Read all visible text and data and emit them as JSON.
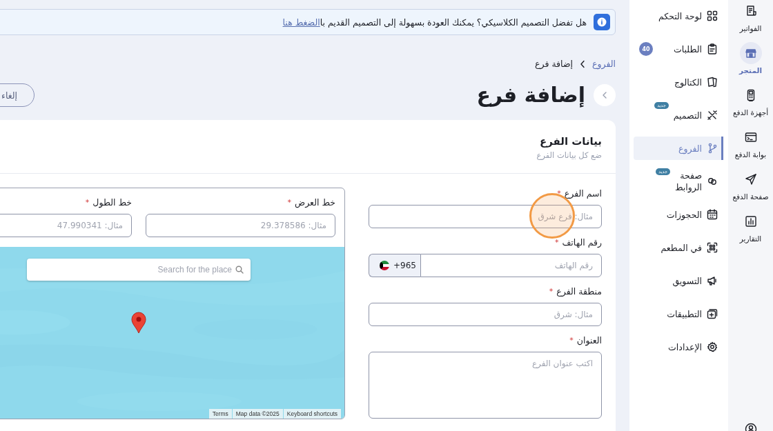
{
  "banner": {
    "text": "هل تفضل التصميم الكلاسيكي؟ يمكنك العودة بسهولة إلى التصميم القديم با",
    "link": "الضغط هنا"
  },
  "breadcrumb": [
    {
      "label": "الفروع",
      "kind": "link"
    },
    {
      "label": "إضافة فرع",
      "kind": "current"
    }
  ],
  "page_title": "إضافة فرع",
  "cancel_button": "إلغاء",
  "card": {
    "title": "بيانات الفرع",
    "subtitle": "ضع كل بيانات الفرع"
  },
  "fields": [
    {
      "kind": "text",
      "label": "اسم الفرع",
      "required_mark": "*",
      "placeholder": "مثال: فرع شرق",
      "touch_marker": true
    },
    {
      "kind": "phone",
      "label": "رقم الهاتف",
      "required_mark": "*",
      "country_code": "+965",
      "placeholder": "رقم الهاتف"
    },
    {
      "kind": "text",
      "label": "منطقة الفرع",
      "required_mark": "*",
      "placeholder": "مثال: شرق"
    },
    {
      "kind": "textarea",
      "label": "العنوان",
      "required_mark": "*",
      "placeholder": "اكتب عنوان الفرع"
    }
  ],
  "location": {
    "fields": [
      {
        "label": "خط العرض",
        "required_mark": "*",
        "placeholder": "مثال: 29.378586"
      },
      {
        "label": "خط الطول",
        "required_mark": "*",
        "placeholder": "مثال: 47.990341"
      }
    ],
    "map": {
      "search_placeholder": "Search for the place",
      "attribution": [
        "Keyboard shortcuts",
        "Map data ©2025",
        "Terms"
      ]
    }
  },
  "sidebar": {
    "items": [
      {
        "label": "لوحة التحكم",
        "selected": false
      },
      {
        "label": "الطلبات",
        "selected": false,
        "badge": {
          "kind": "count",
          "text": "40"
        }
      },
      {
        "label": "الكتالوج",
        "selected": false
      },
      {
        "label": "التصميم",
        "selected": false,
        "badge": {
          "kind": "new",
          "text": "جديد"
        }
      },
      {
        "label": "الفروع",
        "selected": true
      },
      {
        "label": "صفحة\nالروابط",
        "selected": false,
        "badge": {
          "kind": "new",
          "text": "جديد"
        }
      },
      {
        "label": "الحجوزات",
        "selected": false
      },
      {
        "label": "في المطعم",
        "selected": false
      },
      {
        "label": "التسويق",
        "selected": false
      },
      {
        "label": "التطبيقات",
        "selected": false
      },
      {
        "label": "الإعدادات",
        "selected": false
      }
    ]
  },
  "rail": {
    "items": [
      {
        "label": "الفواتير",
        "selected": false
      },
      {
        "label": "المتجر",
        "selected": true
      },
      {
        "label": "أجهزة الدفع",
        "selected": false
      },
      {
        "label": "بوابة الدفع",
        "selected": false
      },
      {
        "label": "صفحة الدفع",
        "selected": false
      },
      {
        "label": "التقارير",
        "selected": false
      }
    ]
  }
}
